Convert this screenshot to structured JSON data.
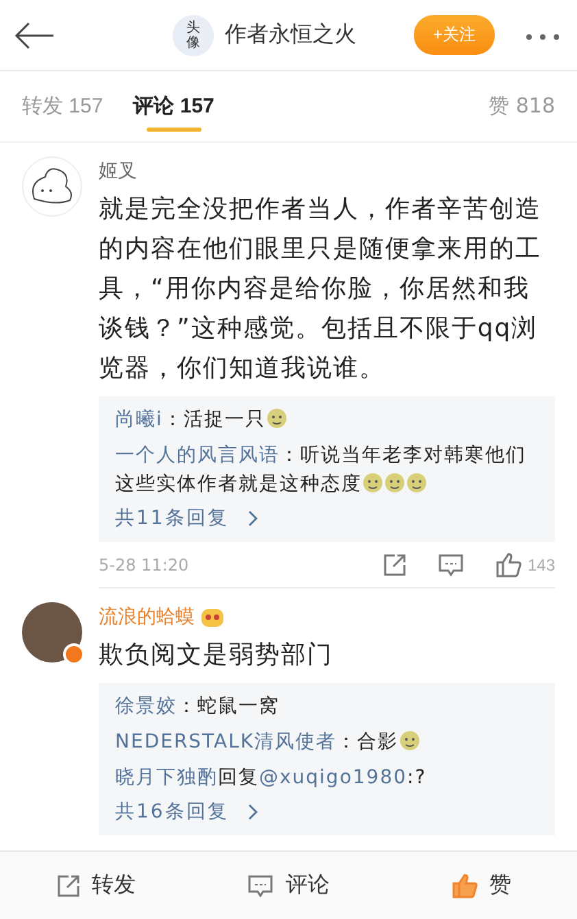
{
  "header": {
    "avatar_text": "头像",
    "title": "作者永恒之火",
    "follow": "+关注"
  },
  "tabs": [
    {
      "label": "转发",
      "count": "157",
      "selected": false
    },
    {
      "label": "评论",
      "count": "157",
      "selected": true
    }
  ],
  "likes_tab": {
    "label": "赞",
    "count": "818"
  },
  "comments": [
    {
      "author": "姬叉",
      "kind": "cartoon",
      "member_badge": false,
      "verified": false,
      "text": "就是完全没把作者当人，作者辛苦创造的内容在他们眼里只是随便拿来用的工具，“用你内容是给你脸，你居然和我谈钱？”这种感觉。包括且不限于qq浏览器，你们知道我说谁。",
      "replies": [
        [
          {
            "kind": "link",
            "text": "尚曦i"
          },
          {
            "kind": "plain",
            "text": "：活捉一只"
          },
          {
            "kind": "emoji"
          }
        ],
        [
          {
            "kind": "link",
            "text": "一个人的风言风语"
          },
          {
            "kind": "plain",
            "text": "：听说当年老李对韩寒他们这些实体作者就是这种态度"
          },
          {
            "kind": "emoji"
          },
          {
            "kind": "emoji"
          },
          {
            "kind": "emoji"
          }
        ]
      ],
      "more": "共11条回复",
      "time": "5-28 11:20",
      "likes": "143"
    },
    {
      "author": "流浪的蛤蟆",
      "kind": "photo",
      "member_badge": true,
      "verified": true,
      "text": "欺负阅文是弱势部门",
      "replies": [
        [
          {
            "kind": "link",
            "text": "徐景姣"
          },
          {
            "kind": "plain",
            "text": "：蛇鼠一窝"
          }
        ],
        [
          {
            "kind": "link",
            "text": "NEDERSTALK清风使者"
          },
          {
            "kind": "plain",
            "text": "：合影"
          },
          {
            "kind": "emoji"
          }
        ],
        [
          {
            "kind": "link",
            "text": "晓月下独酌"
          },
          {
            "kind": "plain",
            "text": "回复"
          },
          {
            "kind": "link",
            "text": "@xuqigo1980"
          },
          {
            "kind": "plain",
            "text": ":?"
          }
        ]
      ],
      "more": "共16条回复"
    }
  ],
  "bottom_bar": [
    {
      "kind": "share",
      "label": "转发"
    },
    {
      "kind": "comment",
      "label": "评论"
    },
    {
      "kind": "like",
      "label": "赞"
    }
  ]
}
